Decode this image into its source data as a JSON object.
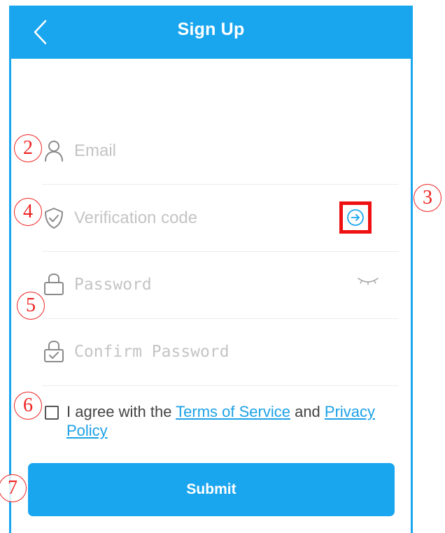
{
  "header": {
    "title": "Sign Up"
  },
  "form": {
    "email_placeholder": "Email",
    "verification_placeholder": "Verification code",
    "password_placeholder": "Password",
    "confirm_password_placeholder": "Confirm Password"
  },
  "agreement": {
    "prefix": "I agree with the ",
    "terms_link": "Terms of Service",
    "conjunction": " and ",
    "privacy_link": "Privacy Policy"
  },
  "submit_label": "Submit",
  "markers": [
    "2",
    "3",
    "4",
    "5",
    "6",
    "7"
  ],
  "colors": {
    "brand": "#1aa6ef",
    "link": "#1ca1e6",
    "annotation": "#ee2222",
    "placeholder": "#c4c4c4"
  },
  "icons": {
    "back": "chevron-left-icon",
    "email": "user-icon",
    "verification": "shield-check-icon",
    "send_code": "arrow-right-circle-icon",
    "password": "lock-icon",
    "visibility": "eye-closed-icon",
    "confirm_password": "lock-check-icon"
  }
}
